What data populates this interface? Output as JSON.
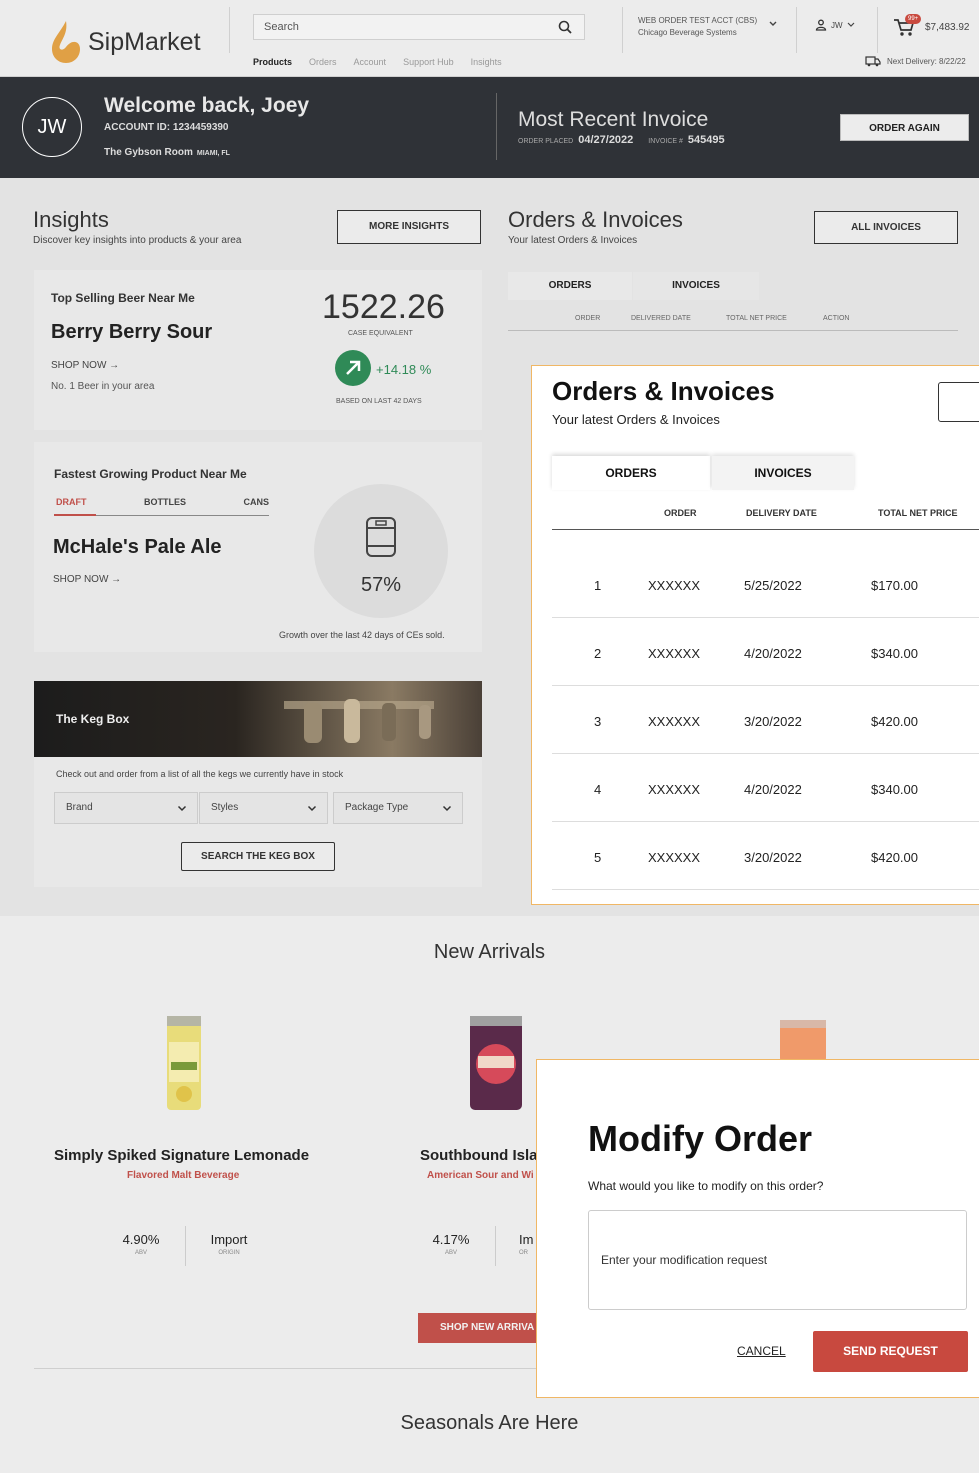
{
  "brand": {
    "name": "SipMarket",
    "accent": "#c0504a",
    "gold": "#e0a045"
  },
  "header": {
    "search_placeholder": "Search",
    "account_line1": "WEB ORDER TEST ACCT (CBS)",
    "account_line2": "Chicago Beverage Systems",
    "user_initials": "JW",
    "cart_badge": "99+",
    "cart_amount": "$7,483.92",
    "nav": [
      "Products",
      "Orders",
      "Account",
      "Support Hub",
      "Insights"
    ],
    "next_delivery": "Next Delivery: 8/22/22"
  },
  "hero": {
    "initials": "JW",
    "welcome": "Welcome back, Joey",
    "account_id": "ACCOUNT ID: 1234459390",
    "room": "The Gybson Room",
    "location": "MIAMI, FL",
    "recent_title": "Most Recent Invoice",
    "order_placed_label": "ORDER PLACED",
    "order_placed": "04/27/2022",
    "invoice_label": "INVOICE #",
    "invoice": "545495",
    "order_again": "ORDER AGAIN"
  },
  "insights": {
    "title": "Insights",
    "subtitle": "Discover key insights into products & your area",
    "more": "MORE INSIGHTS",
    "top": {
      "title": "Top Selling Beer Near Me",
      "name": "Berry Berry Sour",
      "shop": "SHOP NOW",
      "rank": "No. 1 Beer in your area",
      "value": "1522.26",
      "value_label": "CASE EQUIVALENT",
      "change": "+14.18 %",
      "based": "BASED ON LAST 42 DAYS"
    },
    "fastest": {
      "title": "Fastest Growing Product Near Me",
      "tabs": [
        "DRAFT",
        "BOTTLES",
        "CANS"
      ],
      "name": "McHale's Pale Ale",
      "shop": "SHOP NOW",
      "percent": "57%",
      "growth_note": "Growth over the last 42 days of CEs sold."
    },
    "keg": {
      "title": "The Keg Box",
      "desc": "Check out and order from a list of all the kegs we currently have in stock",
      "filters": [
        "Brand",
        "Styles",
        "Package Type"
      ],
      "search": "SEARCH THE KEG BOX"
    }
  },
  "orders_bg": {
    "title": "Orders & Invoices",
    "subtitle": "Your latest Orders & Invoices",
    "all": "ALL INVOICES",
    "tabs": [
      "ORDERS",
      "INVOICES"
    ],
    "cols": [
      "ORDER",
      "DELIVERED DATE",
      "TOTAL NET PRICE",
      "ACTION"
    ]
  },
  "orders_popup": {
    "title": "Orders & Invoices",
    "subtitle": "Your latest Orders & Invoices",
    "tabs": [
      "ORDERS",
      "INVOICES"
    ],
    "cols": [
      "ORDER",
      "DELIVERY DATE",
      "TOTAL NET PRICE"
    ],
    "rows": [
      {
        "n": "1",
        "order": "XXXXXX",
        "date": "5/25/2022",
        "total": "$170.00"
      },
      {
        "n": "2",
        "order": "XXXXXX",
        "date": "4/20/2022",
        "total": "$340.00"
      },
      {
        "n": "3",
        "order": "XXXXXX",
        "date": "3/20/2022",
        "total": "$420.00"
      },
      {
        "n": "4",
        "order": "XXXXXX",
        "date": "4/20/2022",
        "total": "$340.00"
      },
      {
        "n": "5",
        "order": "XXXXXX",
        "date": "3/20/2022",
        "total": "$420.00"
      }
    ]
  },
  "arrivals": {
    "title": "New Arrivals",
    "products": [
      {
        "name": "Simply Spiked Signature Lemonade",
        "type": "Flavored Malt Beverage",
        "abv": "4.90%",
        "abv_label": "ABV",
        "origin": "Import",
        "origin_label": "ORIGIN"
      },
      {
        "name": "Southbound Isla",
        "type": "American Sour and Wi",
        "abv": "4.17%",
        "abv_label": "ABV",
        "origin": "Im",
        "origin_label": "OR"
      }
    ],
    "shop_btn": "SHOP NEW ARRIVA"
  },
  "seasonals": {
    "title": "Seasonals Are Here"
  },
  "modify": {
    "title": "Modify Order",
    "question": "What would you like to modify on this order?",
    "placeholder": "Enter your modification request",
    "cancel": "CANCEL",
    "send": "SEND REQUEST"
  }
}
